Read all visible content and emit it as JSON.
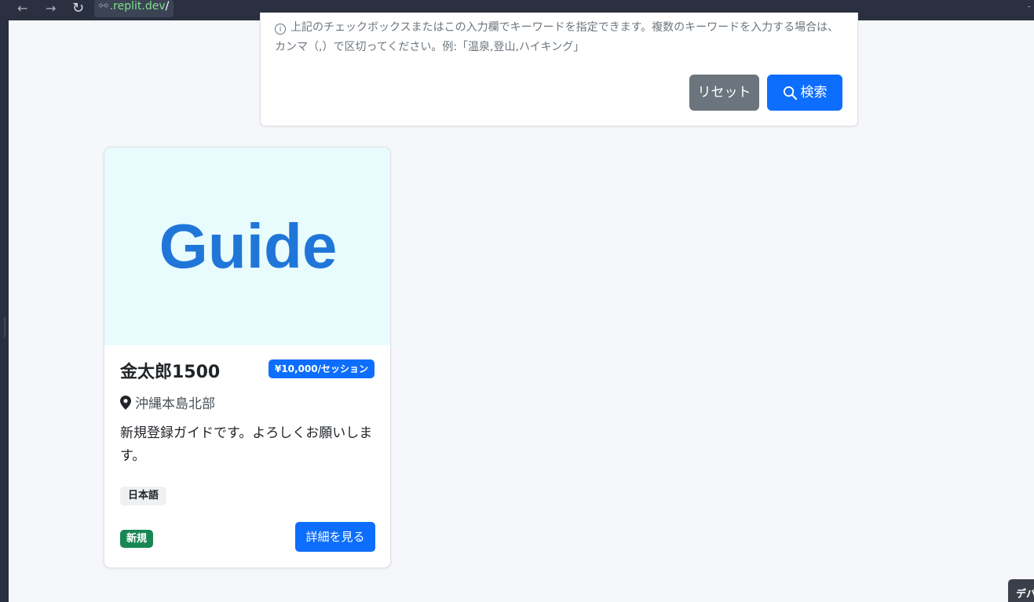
{
  "browser": {
    "url_host": ".replit.dev",
    "url_tail": "/",
    "back_icon": "←",
    "forward_icon": "→",
    "reload_icon": "↻",
    "link_icon": "⚯",
    "corner_mark": "-"
  },
  "search_panel": {
    "help_text": "上記のチェックボックスまたはこの入力欄でキーワードを指定できます。複数のキーワードを入力する場合は、カンマ（,）で区切ってください。例:「温泉,登山,ハイキング」",
    "info_icon": "i",
    "reset_label": "リセット",
    "search_label": "検索"
  },
  "guide_card": {
    "image_text": "Guide",
    "name": "金太郎1500",
    "price": "¥10,000/セッション",
    "location": "沖縄本島北部",
    "description": "新規登録ガイドです。よろしくお願いします。",
    "language": "日本語",
    "badge": "新規",
    "details_label": "詳細を見る"
  },
  "dev_tab": {
    "label": "デバ"
  },
  "colors": {
    "primary": "#0d6efd",
    "secondary": "#6c757d",
    "success": "#198754",
    "thumb_bg": "#e8fbfd",
    "thumb_text": "#2076d8"
  }
}
